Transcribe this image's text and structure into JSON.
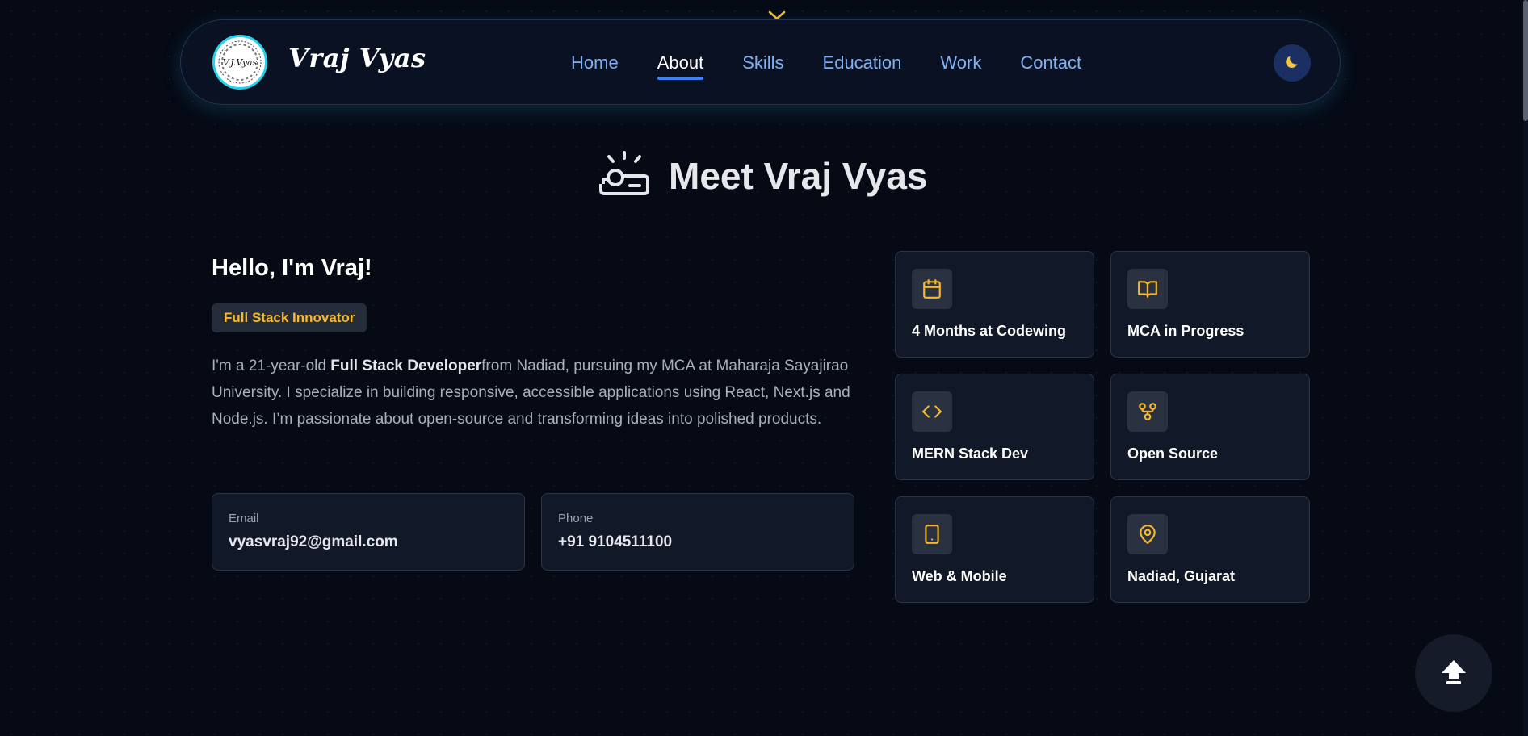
{
  "header": {
    "logo_text": "V.J.Vyas",
    "brand_name": "Vraj Vyas",
    "nav": [
      {
        "label": "Home"
      },
      {
        "label": "About"
      },
      {
        "label": "Skills"
      },
      {
        "label": "Education"
      },
      {
        "label": "Work"
      },
      {
        "label": "Contact"
      }
    ],
    "active_nav": "About"
  },
  "about": {
    "title": "Meet Vraj Vyas",
    "greeting": "Hello, I'm Vraj!",
    "role_badge": "Full Stack Innovator",
    "bio": {
      "prefix": "I'm a 21-year-old ",
      "highlight": "Full Stack Developer",
      "suffix": "from Nadiad, pursuing my MCA at Maharaja Sayajirao University. I specialize in building responsive, accessible applications using React, Next.js and Node.js. I’m passionate about open-source and transforming ideas into polished products."
    },
    "contact": {
      "email_label": "Email",
      "email": "vyasvraj92@gmail.com",
      "phone_label": "Phone",
      "phone": "+91 9104511100"
    },
    "stats": [
      {
        "icon": "calendar-icon",
        "label": "4 Months at Codewing"
      },
      {
        "icon": "book-open-icon",
        "label": "MCA in Progress"
      },
      {
        "icon": "code-icon",
        "label": "MERN Stack Dev"
      },
      {
        "icon": "git-fork-icon",
        "label": "Open Source"
      },
      {
        "icon": "smartphone-icon",
        "label": "Web & Mobile"
      },
      {
        "icon": "map-pin-icon",
        "label": "Nadiad, Gujarat"
      }
    ]
  },
  "colors": {
    "background": "#050a15",
    "accent_amber": "#f5b82e",
    "nav_link": "#7fb2f5",
    "active_underline": "#3b82f6",
    "card_bg": "#111827",
    "logo_ring": "#22d3ee"
  }
}
